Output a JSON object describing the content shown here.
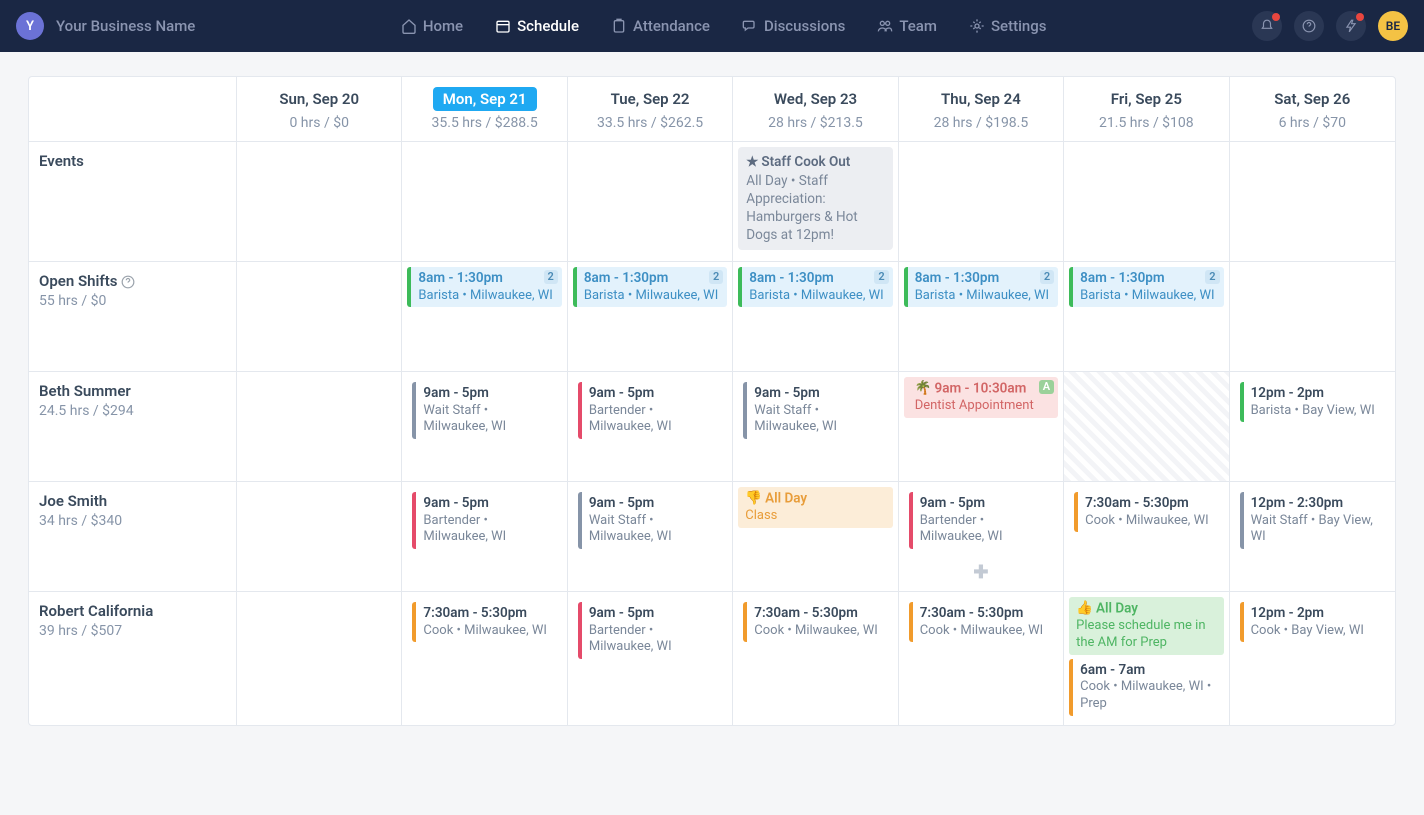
{
  "nav": {
    "business_initial": "Y",
    "business_name": "Your Business Name",
    "items": [
      {
        "label": "Home"
      },
      {
        "label": "Schedule"
      },
      {
        "label": "Attendance"
      },
      {
        "label": "Discussions"
      },
      {
        "label": "Team"
      },
      {
        "label": "Settings"
      }
    ],
    "avatar": "BE"
  },
  "days": [
    {
      "name": "Sun, Sep 20",
      "sub": "0 hrs / $0",
      "active": false
    },
    {
      "name": "Mon, Sep 21",
      "sub": "35.5 hrs / $288.5",
      "active": true
    },
    {
      "name": "Tue, Sep 22",
      "sub": "33.5 hrs / $262.5",
      "active": false
    },
    {
      "name": "Wed, Sep 23",
      "sub": "28 hrs / $213.5",
      "active": false
    },
    {
      "name": "Thu, Sep 24",
      "sub": "28 hrs / $198.5",
      "active": false
    },
    {
      "name": "Fri, Sep 25",
      "sub": "21.5 hrs / $108",
      "active": false
    },
    {
      "name": "Sat, Sep 26",
      "sub": "6 hrs / $70",
      "active": false
    }
  ],
  "rows": {
    "events": {
      "label": "Events"
    },
    "open_shifts": {
      "label": "Open Shifts",
      "sub": "55 hrs / $0"
    },
    "beth": {
      "label": "Beth Summer",
      "sub": "24.5 hrs / $294"
    },
    "joe": {
      "label": "Joe Smith",
      "sub": "34 hrs / $340"
    },
    "robert": {
      "label": "Robert California",
      "sub": "39 hrs / $507"
    }
  },
  "event": {
    "title": "Staff Cook Out",
    "meta": "All Day • Staff Appreciation: Hamburgers & Hot Dogs at 12pm!"
  },
  "open_shift": {
    "time": "8am - 1:30pm",
    "meta": "Barista • Milwaukee, WI",
    "badge": "2"
  },
  "shifts": {
    "beth_mon": {
      "time": "9am - 5pm",
      "meta": "Wait Staff • Milwaukee, WI"
    },
    "beth_tue": {
      "time": "9am - 5pm",
      "meta": "Bartender • Milwaukee, WI"
    },
    "beth_wed": {
      "time": "9am - 5pm",
      "meta": "Wait Staff • Milwaukee, WI"
    },
    "beth_thu": {
      "time": "9am - 10:30am",
      "meta": "Dentist Appointment",
      "badge": "A"
    },
    "beth_sat": {
      "time": "12pm - 2pm",
      "meta": "Barista • Bay View, WI"
    },
    "joe_mon": {
      "time": "9am - 5pm",
      "meta": "Bartender • Milwaukee, WI"
    },
    "joe_tue": {
      "time": "9am - 5pm",
      "meta": "Wait Staff • Milwaukee, WI"
    },
    "joe_wed": {
      "time": "All Day",
      "meta": "Class"
    },
    "joe_thu": {
      "time": "9am - 5pm",
      "meta": "Bartender • Milwaukee, WI"
    },
    "joe_fri": {
      "time": "7:30am - 5:30pm",
      "meta": "Cook • Milwaukee, WI"
    },
    "joe_sat": {
      "time": "12pm - 2:30pm",
      "meta": "Wait Staff • Bay View, WI"
    },
    "rob_mon": {
      "time": "7:30am - 5:30pm",
      "meta": "Cook • Milwaukee, WI"
    },
    "rob_tue": {
      "time": "9am - 5pm",
      "meta": "Bartender • Milwaukee, WI"
    },
    "rob_wed": {
      "time": "7:30am - 5:30pm",
      "meta": "Cook • Milwaukee, WI"
    },
    "rob_thu": {
      "time": "7:30am - 5:30pm",
      "meta": "Cook • Milwaukee, WI"
    },
    "rob_fri_pref": {
      "time": "All Day",
      "meta": "Please schedule me in the AM for Prep"
    },
    "rob_fri_shift": {
      "time": "6am - 7am",
      "meta": "Cook • Milwaukee, WI • Prep"
    },
    "rob_sat": {
      "time": "12pm - 2pm",
      "meta": "Cook • Bay View, WI"
    }
  }
}
